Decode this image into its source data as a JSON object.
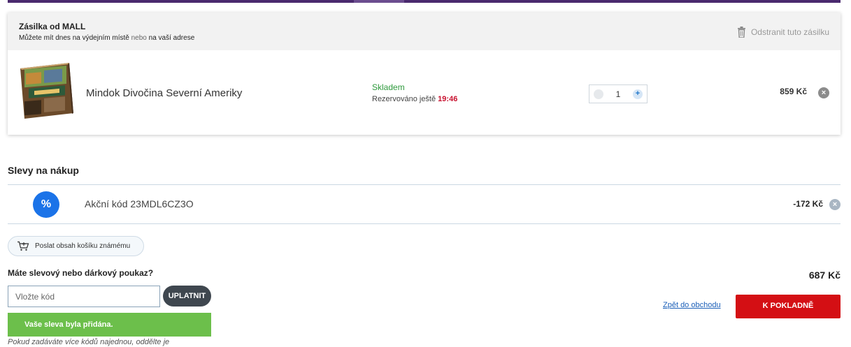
{
  "shipment": {
    "title": "Zásilka od MALL",
    "subtitle_a": "Můžete mít dnes na výdejním místě",
    "subtitle_or": "nebo",
    "subtitle_b": "na vaší adrese",
    "remove_label": "Odstranit tuto zásilku",
    "item": {
      "name": "Mindok Divočina Severní Ameriky",
      "stock": "Skladem",
      "reserved_label": "Rezervováno ještě",
      "reserved_time": "19:46",
      "quantity": "1",
      "price": "859 Kč",
      "minus_icon": "−",
      "plus_icon": "+",
      "remove_icon": "×"
    }
  },
  "discounts": {
    "title": "Slevy na nákup",
    "percent_icon": "%",
    "code_label": "Akční kód 23MDL6CZ3O",
    "amount": "-172 Kč",
    "remove_icon": "×"
  },
  "send_cart_label": "Poslat obsah košíku známému",
  "voucher": {
    "question": "Máte slevový nebo dárkový poukaz?",
    "placeholder": "Vložte kód",
    "apply_label": "UPLATNIT",
    "success_message": "Vaše sleva byla přidána.",
    "hint": "Pokud zadáváte více kódů najednou, oddělte je"
  },
  "total": "687 Kč",
  "back_link": "Zpět do obchodu",
  "checkout_label": "K POKLADNĚ",
  "colors": {
    "brand_bar": "#4a2a6e",
    "stock_green": "#2f9a3d",
    "timer_red": "#c8102e",
    "discount_blue": "#1b73e8",
    "success_green": "#6cbf4b",
    "checkout_red": "#d40f14"
  }
}
